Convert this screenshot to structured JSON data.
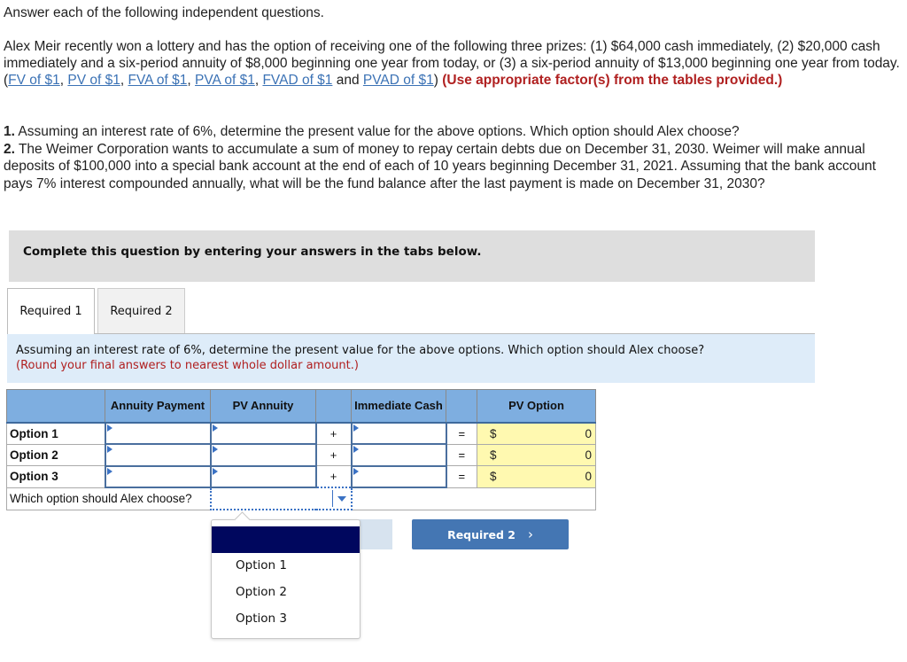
{
  "intro": {
    "heading": "Answer each of the following independent questions.",
    "paragraph_prefix": "Alex Meir recently won a lottery and has the option of receiving one of the following three prizes: (1) $64,000 cash immediately, (2) $20,000 cash immediately and a six-period annuity of $8,000 beginning one year from today, or (3) a six-period annuity of $13,000 beginning one year from today. (",
    "links": [
      "FV of $1",
      "PV of $1",
      "FVA of $1",
      "PVA of $1",
      "FVAD of $1",
      "PVAD of $1"
    ],
    "sep_comma": ", ",
    "sep_and": " and ",
    "close_paren": ") ",
    "instruction": "(Use appropriate factor(s) from the tables provided.)"
  },
  "questions": [
    {
      "num": "1.",
      "text": " Assuming an interest rate of 6%, determine the present value for the above options. Which option should Alex choose?"
    },
    {
      "num": "2.",
      "text": " The Weimer Corporation wants to accumulate a sum of money to repay certain debts due on December 31, 2030. Weimer will make annual deposits of $100,000 into a special bank account at the end of each of 10 years beginning December 31, 2021. Assuming that the bank account pays 7% interest compounded annually, what will be the fund balance after the last payment is made on December 31, 2030?"
    }
  ],
  "complete_box": "Complete this question by entering your answers in the tabs below.",
  "tabs": [
    {
      "label": "Required 1",
      "active": true
    },
    {
      "label": "Required 2",
      "active": false
    }
  ],
  "instruction_panel": {
    "text": "Assuming an interest rate of 6%, determine the present value for the above options. Which option should Alex choose?",
    "note": "(Round your final answers to nearest whole dollar amount.)"
  },
  "table": {
    "headers": [
      "",
      "Annuity Payment",
      "PV Annuity",
      "",
      "Immediate Cash",
      "",
      "PV Option"
    ],
    "rows": [
      {
        "label": "Option 1",
        "annuity_payment": "",
        "pv_annuity": "",
        "plus": "+",
        "immediate_cash": "",
        "equals": "=",
        "currency": "$",
        "pv_option": "0"
      },
      {
        "label": "Option 2",
        "annuity_payment": "",
        "pv_annuity": "",
        "plus": "+",
        "immediate_cash": "",
        "equals": "=",
        "currency": "$",
        "pv_option": "0"
      },
      {
        "label": "Option 3",
        "annuity_payment": "",
        "pv_annuity": "",
        "plus": "+",
        "immediate_cash": "",
        "equals": "=",
        "currency": "$",
        "pv_option": "0"
      }
    ],
    "choose_label": "Which option should Alex choose?",
    "choose_value": ""
  },
  "dropdown": {
    "options": [
      "",
      "Option 1",
      "Option 2",
      "Option 3"
    ],
    "highlighted_index": 0
  },
  "nav": {
    "next_label": "Required 2",
    "next_icon": "chevron-right-icon"
  },
  "colors": {
    "header_blue": "#7eaee0",
    "link_blue": "#3b72b5",
    "instruction_red": "#b02020",
    "result_yellow": "#fff9b0",
    "button_blue": "#4476b3",
    "dropdown_highlight": "#00075e"
  }
}
